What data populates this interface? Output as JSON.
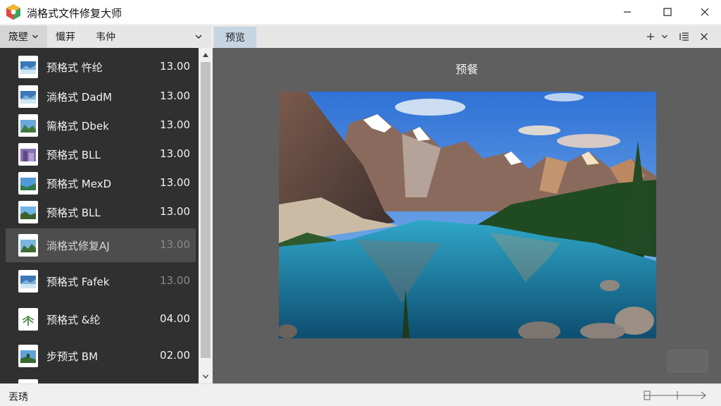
{
  "window": {
    "title": "淌格式文件修复大师"
  },
  "left_toolbar": {
    "tab1": "筬壁",
    "tab2": "懴荓",
    "select_value": "韦仲"
  },
  "right_toolbar": {
    "tab": "预览"
  },
  "files": [
    {
      "name": "预格式 忤纶",
      "size": "13.00",
      "selected": true
    },
    {
      "name": "淌格式 DadM",
      "size": "13.00"
    },
    {
      "name": "篅格式 Dbek",
      "size": "13.00"
    },
    {
      "name": "预格式 BLL",
      "size": "13.00"
    },
    {
      "name": "预格式 MexD",
      "size": "13.00"
    },
    {
      "name": "预格式 BLL",
      "size": "13.00"
    },
    {
      "name": "淌格式修复AJ",
      "size": "13.00",
      "selected": true,
      "dim": true
    },
    {
      "name": "预格式 Fafek",
      "size": "13.00",
      "dim": true
    },
    {
      "name": "预格式 &纶",
      "size": "04.00"
    },
    {
      "name": "步预式 BM",
      "size": "02.00"
    }
  ],
  "preview": {
    "title": "预餐"
  },
  "status": {
    "text": "丟琇"
  },
  "colors": {
    "list_bg": "#303030",
    "preview_bg": "#5f5f5f",
    "selected_row": "#4d4d4d",
    "tab_highlight": "#c7d4e2"
  }
}
